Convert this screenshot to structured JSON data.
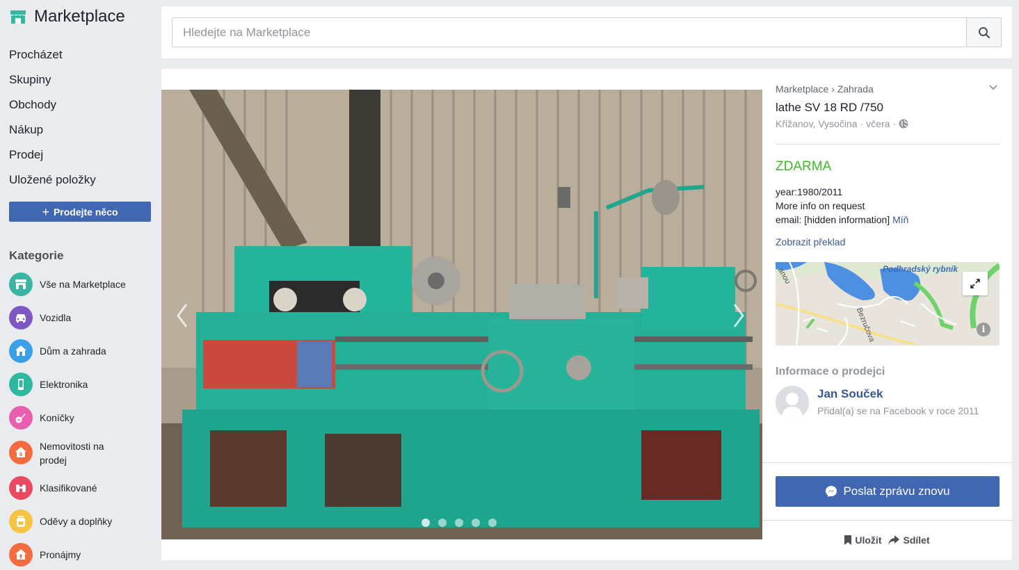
{
  "sidebar": {
    "title": "Marketplace",
    "nav": [
      "Procházet",
      "Skupiny",
      "Obchody",
      "Nákup",
      "Prodej",
      "Uložené položky"
    ],
    "sell_button": "Prodejte něco",
    "categories_heading": "Kategorie",
    "categories": [
      {
        "label": "Vše na Marketplace",
        "icon": "storefront-icon",
        "color": "#3ab5a2"
      },
      {
        "label": "Vozidla",
        "icon": "car-icon",
        "color": "#7e57c2"
      },
      {
        "label": "Dům a zahrada",
        "icon": "house-icon",
        "color": "#3ba0e6"
      },
      {
        "label": "Elektronika",
        "icon": "phone-icon",
        "color": "#2fb7a0"
      },
      {
        "label": "Koníčky",
        "icon": "guitar-icon",
        "color": "#e85fb0"
      },
      {
        "label": "Nemovitosti na prodej",
        "icon": "home-sale-icon",
        "color": "#f36b3f"
      },
      {
        "label": "Klasifikované",
        "icon": "binoculars-icon",
        "color": "#e84a5f"
      },
      {
        "label": "Oděvy a doplňky",
        "icon": "backpack-icon",
        "color": "#f6c443"
      },
      {
        "label": "Pronájmy",
        "icon": "home-key-icon",
        "color": "#f36b3f"
      }
    ]
  },
  "search": {
    "placeholder": "Hledejte na Marketplace"
  },
  "listing": {
    "breadcrumb": "Marketplace › Zahrada",
    "title": "lathe SV 18 RD /750",
    "location": "Křižanov, Vysočina",
    "posted": "včera",
    "price": "ZDARMA",
    "description_lines": [
      "year:1980/2011",
      "More info on request",
      "email: [hidden information]"
    ],
    "less_link": "Míň",
    "translate_link": "Zobrazit překlad",
    "map_lake_label": "Podhradský rybník",
    "map_street_label": "Bezručova",
    "map_street2_label": "anou",
    "photo_count": 5,
    "active_photo": 1
  },
  "seller": {
    "heading": "Informace o prodejci",
    "name": "Jan Souček",
    "joined": "Přidal(a) se na Facebook v roce 2011"
  },
  "actions": {
    "message_button": "Poslat zprávu znovu",
    "save": "Uložit",
    "share": "Sdílet"
  },
  "colors": {
    "brand_blue": "#4267b2",
    "link_blue": "#385898",
    "price_green": "#42b72a",
    "page_bg": "#e9ebee"
  }
}
